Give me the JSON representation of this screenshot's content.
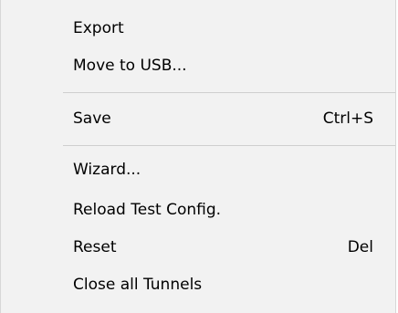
{
  "menu": {
    "items": [
      {
        "label": "Export",
        "shortcut": ""
      },
      {
        "label": "Move to USB...",
        "shortcut": ""
      },
      {
        "label": "Save",
        "shortcut": "Ctrl+S"
      },
      {
        "label": "Wizard...",
        "shortcut": ""
      },
      {
        "label": "Reload Test Config.",
        "shortcut": ""
      },
      {
        "label": "Reset",
        "shortcut": "Del"
      },
      {
        "label": "Close all Tunnels",
        "shortcut": ""
      }
    ]
  }
}
